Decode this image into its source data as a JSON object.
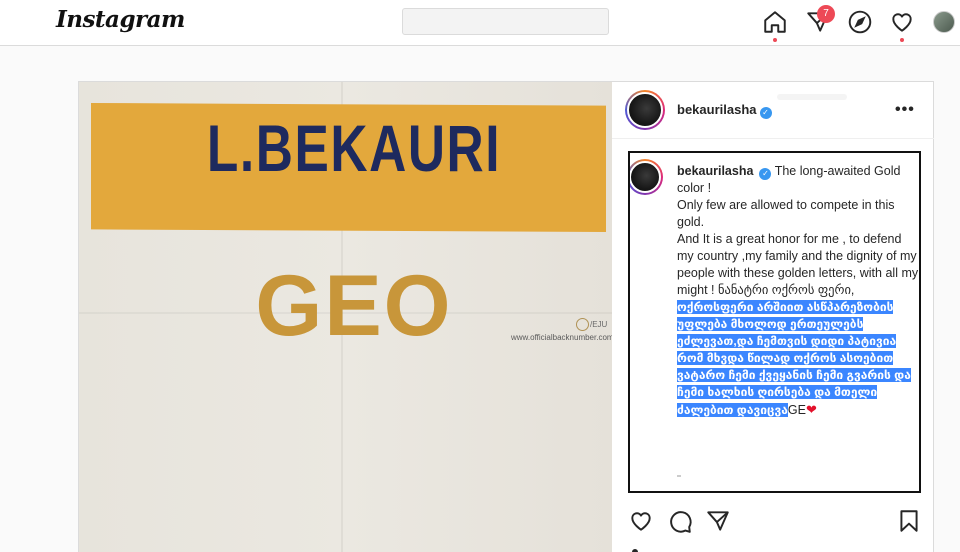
{
  "app": {
    "logo_text": "Instagram"
  },
  "nav": {
    "search_placeholder": "",
    "notifications_count": "7",
    "icons": [
      "home-icon",
      "direct-message-icon",
      "explore-compass-icon",
      "activity-heart-icon",
      "profile-avatar"
    ]
  },
  "post": {
    "username": "bekaurilasha",
    "verified": true,
    "more_label": "•••",
    "image": {
      "name_text": "L.BEKAURI",
      "country_text": "GEO",
      "watermark_side": "/EJU",
      "watermark_url": "www.officialbacknumber.com"
    },
    "caption": {
      "username": "bekaurilasha",
      "lines_plain": [
        "The long-awaited Gold color !",
        "Only few are allowed to compete in this gold.",
        "And It is a great honor for me , to defend my country ,my family and the dignity of my people with these golden letters, with all my might ! ნანატრი ოქროს ფერი,"
      ],
      "highlighted": "ოქროსფერი არშიით ასწპარეზობის უფლება მხოლოდ ერთეულებს ეძლევათ,და ჩემთვის დიდი პატივია რომ მხვდა წილად ოქროს ასოებით ვატარო ჩემი ქვეყანის ჩემი გვარის და ჩემი ხალხის ღირსება და მთელი ძალებით დავიცვა",
      "suffix": "GE",
      "emoji": "❤"
    }
  },
  "colors": {
    "accent_blue": "#3897f0",
    "highlight": "#3b86ff",
    "badge_red": "#ed4956",
    "banner_gold": "#e3a83c",
    "name_navy": "#1e2a5e"
  }
}
